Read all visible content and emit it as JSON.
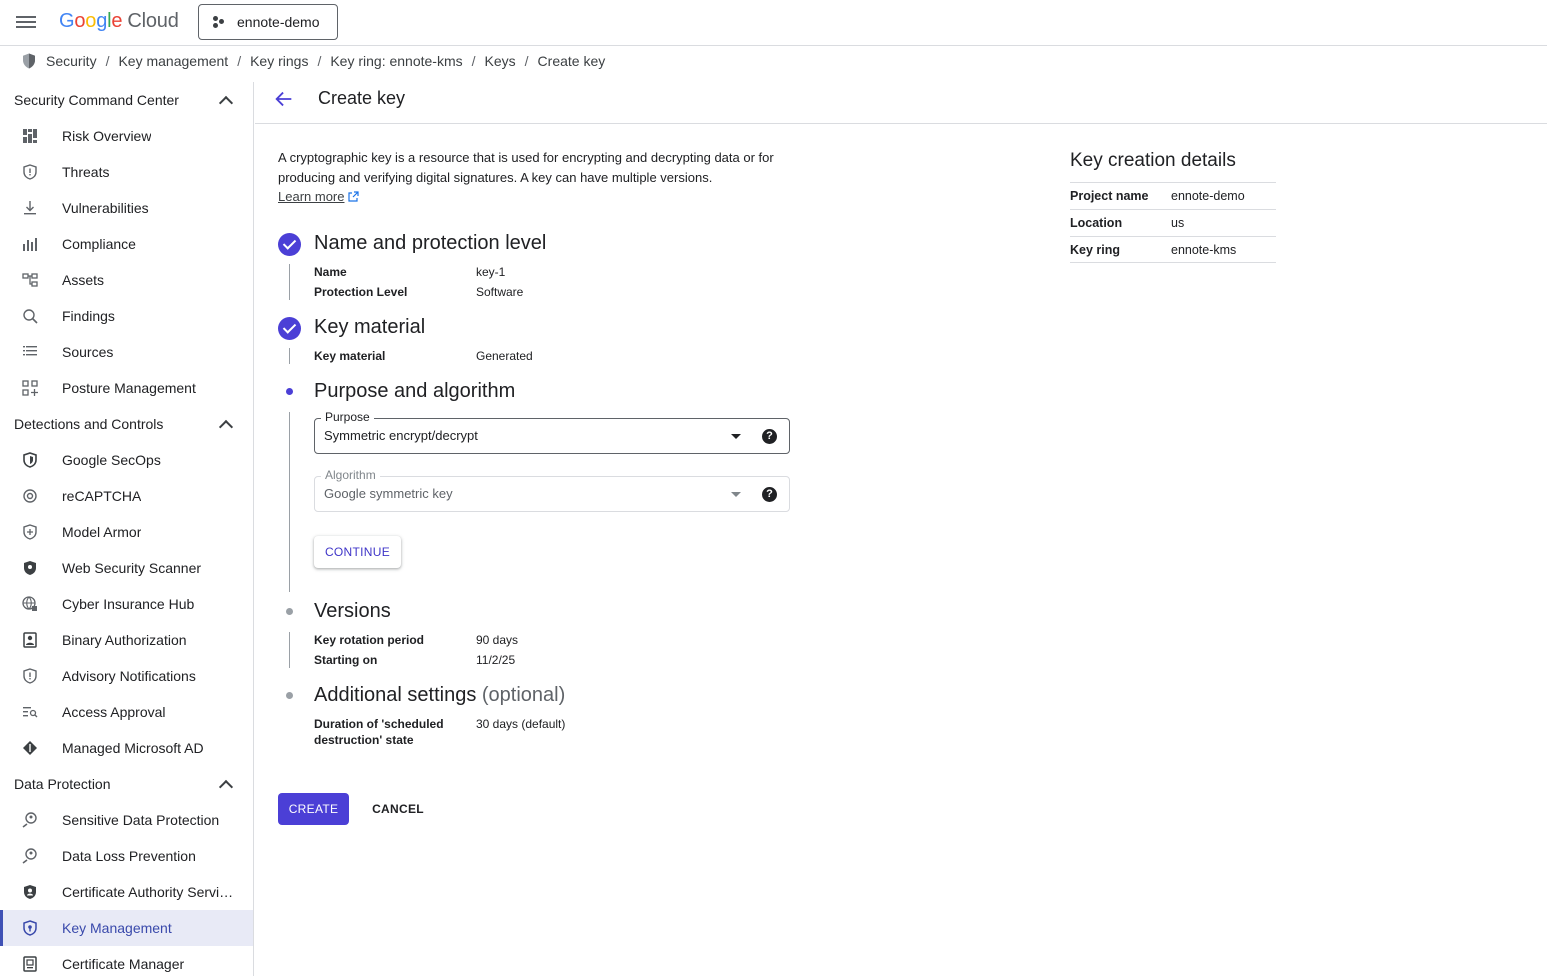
{
  "topbar": {
    "logo_google": "Google",
    "logo_cloud": "Cloud",
    "project": "ennote-demo"
  },
  "breadcrumb": [
    "Security",
    "Key management",
    "Key rings",
    "Key ring: ennote-kms",
    "Keys",
    "Create key"
  ],
  "sidebar": {
    "sections": [
      {
        "title": "Security Command Center",
        "items": [
          {
            "label": "Risk Overview",
            "icon": "dashboard-icon"
          },
          {
            "label": "Threats",
            "icon": "shield-alert-icon"
          },
          {
            "label": "Vulnerabilities",
            "icon": "download-icon"
          },
          {
            "label": "Compliance",
            "icon": "bar-chart-icon"
          },
          {
            "label": "Assets",
            "icon": "hierarchy-icon"
          },
          {
            "label": "Findings",
            "icon": "search-doc-icon"
          },
          {
            "label": "Sources",
            "icon": "list-icon"
          },
          {
            "label": "Posture Management",
            "icon": "grid-plus-icon"
          }
        ]
      },
      {
        "title": "Detections and Controls",
        "items": [
          {
            "label": "Google SecOps",
            "icon": "shield-icon"
          },
          {
            "label": "reCAPTCHA",
            "icon": "recaptcha-icon"
          },
          {
            "label": "Model Armor",
            "icon": "shield-plus-icon"
          },
          {
            "label": "Web Security Scanner",
            "icon": "shield-half-icon"
          },
          {
            "label": "Cyber Insurance Hub",
            "icon": "globe-lock-icon"
          },
          {
            "label": "Binary Authorization",
            "icon": "badge-icon"
          },
          {
            "label": "Advisory Notifications",
            "icon": "shield-alert-icon"
          },
          {
            "label": "Access Approval",
            "icon": "list-search-icon"
          },
          {
            "label": "Managed Microsoft AD",
            "icon": "directory-icon"
          }
        ]
      },
      {
        "title": "Data Protection",
        "items": [
          {
            "label": "Sensitive Data Protection",
            "icon": "search-person-icon"
          },
          {
            "label": "Data Loss Prevention",
            "icon": "search-person-icon"
          },
          {
            "label": "Certificate Authority Servi…",
            "icon": "shield-person-icon"
          },
          {
            "label": "Key Management",
            "icon": "shield-key-icon",
            "active": true
          },
          {
            "label": "Certificate Manager",
            "icon": "certificate-icon"
          }
        ]
      }
    ]
  },
  "page": {
    "title": "Create key",
    "intro": "A cryptographic key is a resource that is used for encrypting and decrypting data or for producing and verifying digital signatures. A key can have multiple versions.",
    "learn_more": "Learn more"
  },
  "steps": {
    "name_protection": {
      "title": "Name and protection level",
      "name_label": "Name",
      "name_value": "key-1",
      "protection_label": "Protection Level",
      "protection_value": "Software"
    },
    "key_material": {
      "title": "Key material",
      "label": "Key material",
      "value": "Generated"
    },
    "purpose": {
      "title": "Purpose and algorithm",
      "purpose_label": "Purpose",
      "purpose_value": "Symmetric encrypt/decrypt",
      "algorithm_label": "Algorithm",
      "algorithm_value": "Google symmetric key",
      "continue_label": "CONTINUE"
    },
    "versions": {
      "title": "Versions",
      "rotation_label": "Key rotation period",
      "rotation_value": "90 days",
      "start_label": "Starting on",
      "start_value": "11/2/25"
    },
    "additional": {
      "title": "Additional settings",
      "optional": "(optional)",
      "duration_label": "Duration of 'scheduled destruction' state",
      "duration_value": "30 days (default)"
    }
  },
  "actions": {
    "create": "CREATE",
    "cancel": "CANCEL"
  },
  "details": {
    "title": "Key creation details",
    "rows": [
      {
        "label": "Project name",
        "value": "ennote-demo"
      },
      {
        "label": "Location",
        "value": "us"
      },
      {
        "label": "Key ring",
        "value": "ennote-kms"
      }
    ]
  },
  "colors": {
    "accent": "#4b3fd6",
    "active_nav_bg": "#e8eaf6",
    "active_nav_text": "#3949ab"
  }
}
